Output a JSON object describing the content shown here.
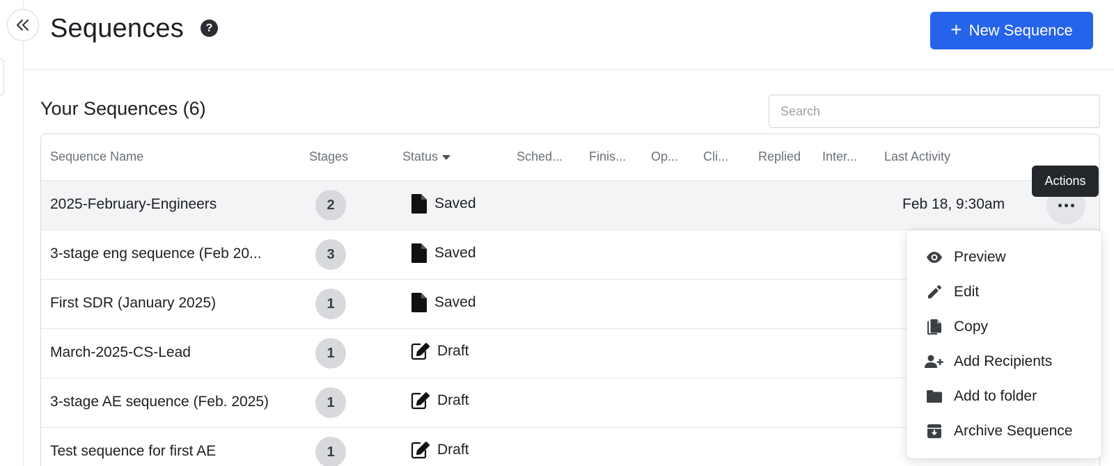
{
  "header": {
    "title": "Sequences",
    "help_icon": "?",
    "new_button_icon": "+",
    "new_button_label": "New Sequence"
  },
  "section": {
    "title": "Your Sequences (6)",
    "search_placeholder": "Search"
  },
  "table": {
    "columns": [
      "Sequence Name",
      "Stages",
      "Status",
      "Sched...",
      "Finis...",
      "Op...",
      "Cli...",
      "Replied",
      "Inter...",
      "Last Activity"
    ],
    "rows": [
      {
        "name": "2025-February-Engineers",
        "stages": "2",
        "status": "Saved",
        "status_icon": "document-icon",
        "last_activity": "Feb 18, 9:30am"
      },
      {
        "name": "3-stage eng sequence (Feb 20...",
        "stages": "3",
        "status": "Saved",
        "status_icon": "document-icon",
        "last_activity": ""
      },
      {
        "name": "First SDR (January 2025)",
        "stages": "1",
        "status": "Saved",
        "status_icon": "document-icon",
        "last_activity": ""
      },
      {
        "name": "March-2025-CS-Lead",
        "stages": "1",
        "status": "Draft",
        "status_icon": "edit-note-icon",
        "last_activity": ""
      },
      {
        "name": "3-stage AE sequence (Feb. 2025)",
        "stages": "1",
        "status": "Draft",
        "status_icon": "edit-note-icon",
        "last_activity": ""
      },
      {
        "name": "Test sequence for first AE",
        "stages": "1",
        "status": "Draft",
        "status_icon": "edit-note-icon",
        "last_activity": ""
      }
    ]
  },
  "tooltip": "Actions",
  "menu": {
    "items": [
      {
        "label": "Preview",
        "icon": "eye-icon"
      },
      {
        "label": "Edit",
        "icon": "pencil-icon"
      },
      {
        "label": "Copy",
        "icon": "copy-icon"
      },
      {
        "label": "Add Recipients",
        "icon": "add-person-icon"
      },
      {
        "label": "Add to folder",
        "icon": "folder-icon"
      },
      {
        "label": "Archive Sequence",
        "icon": "archive-icon"
      }
    ]
  },
  "colors": {
    "primary": "#2563eb",
    "tooltip_bg": "#24272b",
    "badge_bg": "#d7d9dc",
    "row_hover": "#f3f4f6"
  }
}
